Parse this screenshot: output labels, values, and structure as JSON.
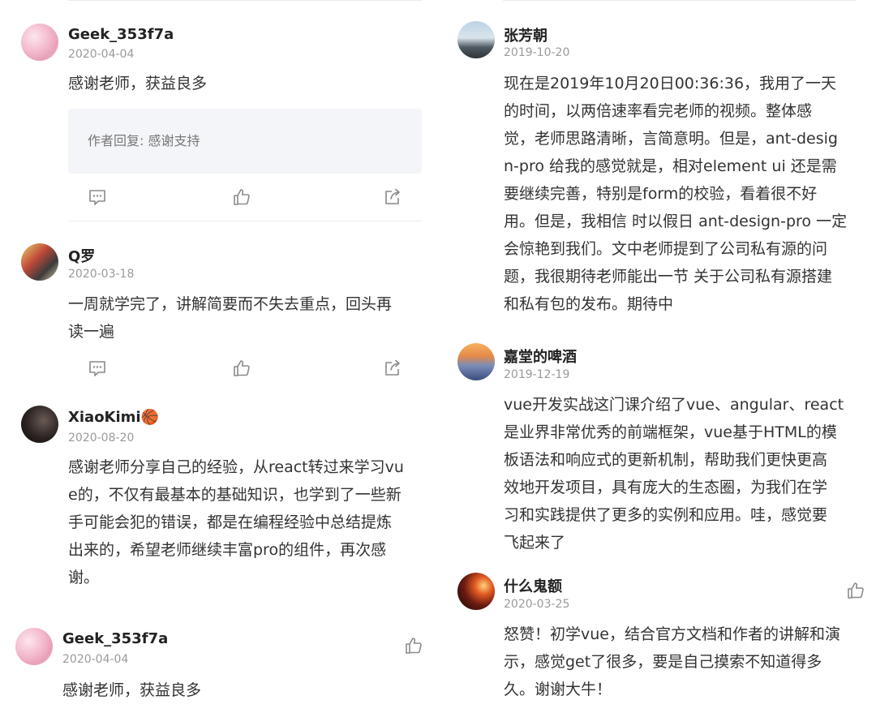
{
  "left": {
    "comments": [
      {
        "user": "Geek_353f7a",
        "date": "2020-04-04",
        "text": "感谢老师，获益良多",
        "reply": "作者回复: 感谢支持"
      },
      {
        "user": "Q罗",
        "date": "2020-03-18",
        "lines": [
          "一周就学完了，讲解简要而不失去重点，回头再",
          "读一遍"
        ]
      },
      {
        "user": "XiaoKimi🏀",
        "date": "2020-08-20",
        "lines": [
          "感谢老师分享自己的经验，从react转过来学习vu",
          "e的，不仅有最基本的基础知识，也学到了一些新",
          "手可能会犯的错误，都是在编程经验中总结提炼",
          "出来的，希望老师继续丰富pro的组件，再次感",
          "谢。"
        ]
      },
      {
        "user": "Geek_353f7a",
        "date": "2020-04-04",
        "text": "感谢老师，获益良多"
      }
    ]
  },
  "right": {
    "comments": [
      {
        "user": "张芳朝",
        "date": "2019-10-20",
        "lines": [
          "现在是2019年10月20日00:36:36，我用了一天",
          "的时间，以两倍速率看完老师的视频。整体感",
          "觉，老师思路清晰，言简意明。但是，ant-desig",
          "n-pro 给我的感觉就是，相对element ui 还是需",
          "要继续完善，特别是form的校验，看着很不好",
          "用。但是，我相信 时以假日 ant-design-pro 一定",
          "会惊艳到我们。文中老师提到了公司私有源的问",
          "题，我很期待老师能出一节 关于公司私有源搭建",
          "和私有包的发布。期待中"
        ]
      },
      {
        "user": "嘉堂的啤酒",
        "date": "2019-12-19",
        "lines": [
          "vue开发实战这门课介绍了vue、angular、react",
          "是业界非常优秀的前端框架，vue基于HTML的模",
          "板语法和响应式的更新机制，帮助我们更快更高",
          "效地开发项目，具有庞大的生态圈，为我们在学",
          "习和实践提供了更多的实例和应用。哇，感觉要",
          "飞起来了"
        ]
      },
      {
        "user": "什么鬼额",
        "date": "2020-03-25",
        "lines": [
          "怒赞！初学vue，结合官方文档和作者的讲解和演",
          "示，感觉get了很多，要是自己摸索不知道得多",
          "久。谢谢大牛！"
        ]
      }
    ]
  },
  "icons": {
    "comment": "comment-icon",
    "like": "thumbs-up-icon",
    "share": "share-icon"
  },
  "colors": {
    "username": "#222222",
    "date": "#9a9a9a",
    "reply_bg": "#f4f5f8",
    "icon": "#8a8a8a"
  }
}
